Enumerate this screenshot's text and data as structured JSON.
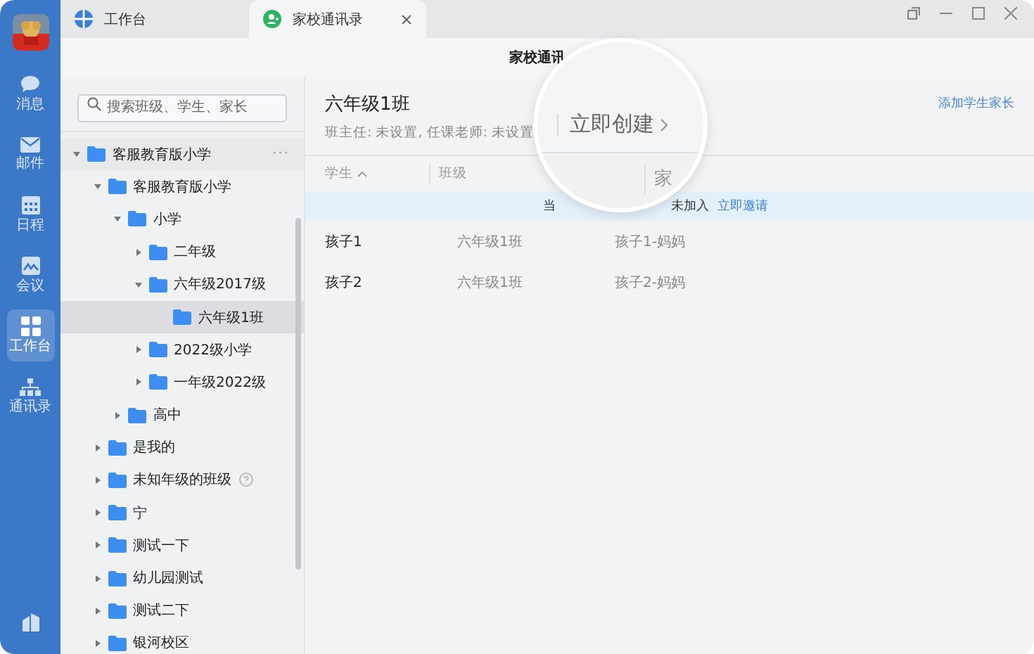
{
  "rail": {
    "items": [
      {
        "label": "消息",
        "selected": false
      },
      {
        "label": "邮件",
        "selected": false
      },
      {
        "label": "日程",
        "selected": false
      },
      {
        "label": "会议",
        "selected": false
      },
      {
        "label": "工作台",
        "selected": true
      },
      {
        "label": "通讯录",
        "selected": false
      }
    ]
  },
  "tabs": [
    {
      "label": "工作台",
      "selected": false,
      "closable": false
    },
    {
      "label": "家校通讯录",
      "selected": true,
      "closable": true
    }
  ],
  "header": {
    "title": "家校通讯"
  },
  "search": {
    "placeholder": "搜索班级、学生、家长"
  },
  "tree": [
    {
      "label": "客服教育版小学",
      "expanded": true,
      "selected": false,
      "hovered": true,
      "more": "···",
      "children": [
        {
          "label": "客服教育版小学",
          "expanded": true,
          "selected": false,
          "children": [
            {
              "label": "小学",
              "expanded": true,
              "selected": false,
              "children": [
                {
                  "label": "二年级",
                  "expanded": false,
                  "selected": false
                },
                {
                  "label": "六年级2017级",
                  "expanded": true,
                  "selected": false,
                  "children": [
                    {
                      "label": "六年级1班",
                      "selected": true
                    }
                  ]
                },
                {
                  "label": "2022级小学",
                  "expanded": false,
                  "selected": false
                },
                {
                  "label": "一年级2022级",
                  "expanded": false,
                  "selected": false
                }
              ]
            },
            {
              "label": "高中",
              "expanded": false,
              "selected": false
            }
          ]
        },
        {
          "label": "是我的",
          "expanded": false,
          "selected": false
        },
        {
          "label": "未知年级的班级",
          "expanded": false,
          "selected": false,
          "help": true
        },
        {
          "label": "宁",
          "expanded": false,
          "selected": false
        },
        {
          "label": "测试一下",
          "expanded": false,
          "selected": false
        },
        {
          "label": "幼儿园测试",
          "expanded": false,
          "selected": false
        },
        {
          "label": "测试二下",
          "expanded": false,
          "selected": false
        },
        {
          "label": "银河校区",
          "expanded": false,
          "selected": false
        }
      ]
    }
  ],
  "class_panel": {
    "title": "六年级1班",
    "subtitle": "班主任: 未设置, 任课老师: 未设置",
    "add_link": "添加学生家长"
  },
  "table": {
    "columns": [
      {
        "label": "学生",
        "sorted": true
      },
      {
        "label": "班级",
        "sorted": false
      }
    ],
    "banner": {
      "text_before": "当",
      "text_after": "未加入",
      "link": "立即邀请"
    },
    "rows": [
      {
        "student": "孩子1",
        "class": "六年级1班",
        "parent": "孩子1-妈妈"
      },
      {
        "student": "孩子2",
        "class": "六年级1班",
        "parent": "孩子2-妈妈"
      }
    ]
  },
  "magnifier": {
    "action": "立即创建",
    "column": "家"
  }
}
